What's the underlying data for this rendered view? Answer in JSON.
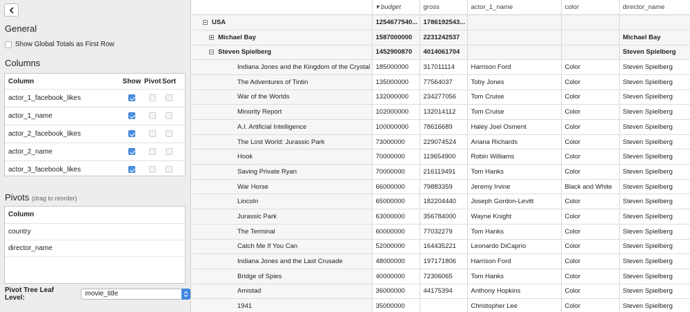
{
  "panel": {
    "general_title": "General",
    "global_totals_label": "Show Global Totals as First Row",
    "columns_title": "Columns",
    "columns_headers": {
      "column": "Column",
      "show": "Show",
      "pivot": "Pivot",
      "sort": "Sort"
    },
    "columns": [
      {
        "name": "actor_1_facebook_likes",
        "show": true,
        "pivot": false,
        "sort": false
      },
      {
        "name": "actor_1_name",
        "show": true,
        "pivot": false,
        "sort": false
      },
      {
        "name": "actor_2_facebook_likes",
        "show": true,
        "pivot": false,
        "sort": false
      },
      {
        "name": "actor_2_name",
        "show": true,
        "pivot": false,
        "sort": false
      },
      {
        "name": "actor_3_facebook_likes",
        "show": true,
        "pivot": false,
        "sort": false
      }
    ],
    "pivots_title": "Pivots",
    "pivots_subtitle": "(drag to reorder)",
    "pivots_header": "Column",
    "pivots": [
      "country",
      "director_name"
    ],
    "leaf_label": "Pivot Tree Leaf Level:",
    "leaf_value": "movie_title"
  },
  "grid": {
    "headers": [
      "",
      "▾ budget",
      "gross",
      "actor_1_name",
      "color",
      "director_name"
    ],
    "rows": [
      {
        "type": "group",
        "level": 0,
        "toggle": "minus",
        "cells": [
          "USA",
          "1254677540...",
          "1786192543...",
          "",
          "",
          ""
        ]
      },
      {
        "type": "group",
        "level": 1,
        "toggle": "plus",
        "cells": [
          "Michael Bay",
          "1587000000",
          "2231242537",
          "",
          "",
          "Michael Bay"
        ]
      },
      {
        "type": "group",
        "level": 1,
        "toggle": "minus",
        "cells": [
          "Steven Spielberg",
          "1452900870",
          "4014061704",
          "",
          "",
          "Steven Spielberg"
        ]
      },
      {
        "type": "leaf",
        "cells": [
          "Indiana Jones and the Kingdom of the Crystal Skull",
          "185000000",
          "317011114",
          "Harrison Ford",
          "Color",
          "Steven Spielberg"
        ]
      },
      {
        "type": "leaf",
        "cells": [
          "The Adventures of Tintin",
          "135000000",
          "77564037",
          "Toby Jones",
          "Color",
          "Steven Spielberg"
        ]
      },
      {
        "type": "leaf",
        "cells": [
          "War of the Worlds",
          "132000000",
          "234277056",
          "Tom Cruise",
          "Color",
          "Steven Spielberg"
        ]
      },
      {
        "type": "leaf",
        "cells": [
          "Minority Report",
          "102000000",
          "132014112",
          "Tom Cruise",
          "Color",
          "Steven Spielberg"
        ]
      },
      {
        "type": "leaf",
        "cells": [
          "A.I. Artificial Intelligence",
          "100000000",
          "78616689",
          "Haley Joel Osment",
          "Color",
          "Steven Spielberg"
        ]
      },
      {
        "type": "leaf",
        "cells": [
          "The Lost World: Jurassic Park",
          "73000000",
          "229074524",
          "Ariana Richards",
          "Color",
          "Steven Spielberg"
        ]
      },
      {
        "type": "leaf",
        "cells": [
          "Hook",
          "70000000",
          "119654900",
          "Robin Williams",
          "Color",
          "Steven Spielberg"
        ]
      },
      {
        "type": "leaf",
        "cells": [
          "Saving Private Ryan",
          "70000000",
          "216119491",
          "Tom Hanks",
          "Color",
          "Steven Spielberg"
        ]
      },
      {
        "type": "leaf",
        "cells": [
          "War Horse",
          "66000000",
          "79883359",
          "Jeremy Irvine",
          "Black and White",
          "Steven Spielberg"
        ]
      },
      {
        "type": "leaf",
        "cells": [
          "Lincoln",
          "65000000",
          "182204440",
          "Joseph Gordon-Levitt",
          "Color",
          "Steven Spielberg"
        ]
      },
      {
        "type": "leaf",
        "cells": [
          "Jurassic Park",
          "63000000",
          "356784000",
          "Wayne Knight",
          "Color",
          "Steven Spielberg"
        ]
      },
      {
        "type": "leaf",
        "cells": [
          "The Terminal",
          "60000000",
          "77032279",
          "Tom Hanks",
          "Color",
          "Steven Spielberg"
        ]
      },
      {
        "type": "leaf",
        "cells": [
          "Catch Me If You Can",
          "52000000",
          "164435221",
          "Leonardo DiCaprio",
          "Color",
          "Steven Spielberg"
        ]
      },
      {
        "type": "leaf",
        "cells": [
          "Indiana Jones and the Last Crusade",
          "48000000",
          "197171806",
          "Harrison Ford",
          "Color",
          "Steven Spielberg"
        ]
      },
      {
        "type": "leaf",
        "cells": [
          "Bridge of Spies",
          "40000000",
          "72306065",
          "Tom Hanks",
          "Color",
          "Steven Spielberg"
        ]
      },
      {
        "type": "leaf",
        "cells": [
          "Amistad",
          "36000000",
          "44175394",
          "Anthony Hopkins",
          "Color",
          "Steven Spielberg"
        ]
      },
      {
        "type": "leaf",
        "cells": [
          "1941",
          "35000000",
          "",
          "Christopher Lee",
          "Color",
          "Steven Spielberg"
        ]
      }
    ]
  }
}
